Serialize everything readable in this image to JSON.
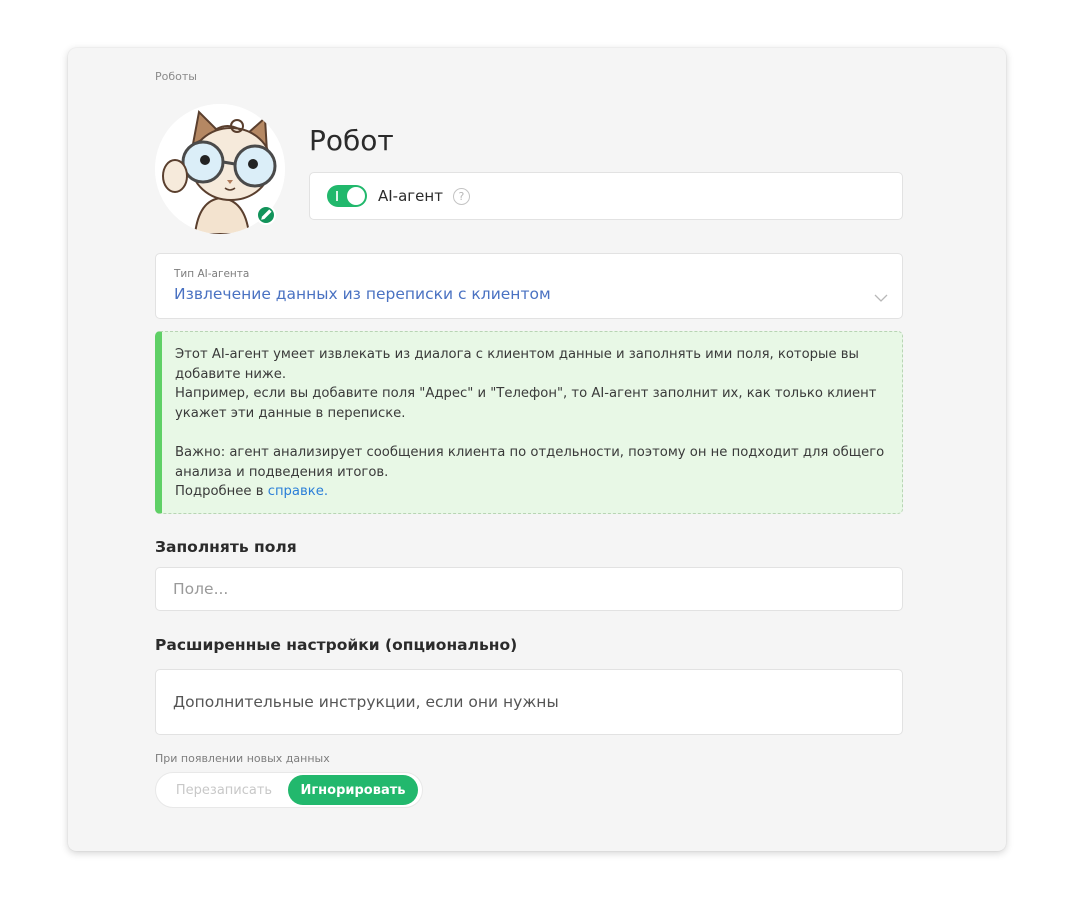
{
  "breadcrumb": "Роботы",
  "robot": {
    "title": "Робот",
    "agent_toggle_label": "AI-агент",
    "agent_toggle_on": true,
    "help_glyph": "?"
  },
  "agent_type": {
    "caption": "Тип AI-агента",
    "value": "Извлечение данных из переписки с клиентом"
  },
  "info": {
    "p1": "Этот AI-агент умеет извлекать из диалога с клиентом данные и заполнять ими поля, которые вы добавите ниже.",
    "p2": "Например, если вы добавите поля \"Адрес\" и \"Телефон\", то AI-агент заполнит их, как только клиент укажет эти данные в переписке.",
    "p3": "Важно: агент анализирует сообщения клиента по отдельности, поэтому он не подходит для общего анализа и подведения итогов.",
    "more_prefix": "Подробнее в ",
    "more_link": "справке."
  },
  "fields": {
    "heading": "Заполнять поля",
    "placeholder": "Поле..."
  },
  "advanced": {
    "heading": "Расширенные настройки (опционально)",
    "placeholder": "Дополнительные инструкции, если они нужны"
  },
  "new_data": {
    "caption": "При появлении новых данных",
    "options": [
      "Перезаписать",
      "Игнорировать"
    ],
    "selected": "Игнорировать"
  },
  "colors": {
    "accent_green": "#22b86d",
    "link_blue": "#2b7fd8",
    "info_bg": "#e8f8e6",
    "info_bar": "#5fd066"
  },
  "icons": [
    "cat-avatar-icon",
    "pencil-icon",
    "help-icon",
    "chevron-down-icon"
  ]
}
